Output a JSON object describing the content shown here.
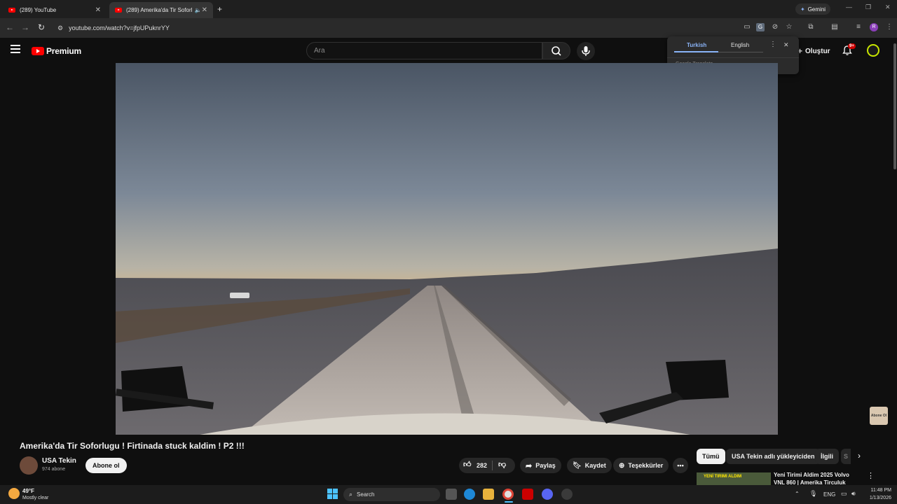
{
  "browser": {
    "tabs": [
      {
        "title": "(289) YouTube"
      },
      {
        "title": "(289) Amerika'da Tir Soforlu"
      }
    ],
    "new_tab": "+",
    "gemini_label": "Gemini",
    "url": "youtube.com/watch?v=jfpUPuknrYY",
    "profile_initial": "R"
  },
  "youtube": {
    "logo_text": "Premium",
    "search_placeholder": "Ara",
    "create_label": "Oluştur",
    "notifications_badge": "9+"
  },
  "translate_popup": {
    "lang_from": "Turkish",
    "lang_to": "English",
    "brand": "Google Translate"
  },
  "video": {
    "title": "Amerika'da Tir Soforlugu ! Firtinada stuck kaldim ! P2 !!!",
    "channel": "USA Tekin",
    "subscribers": "974 abone",
    "subscribe_label": "Abone ol",
    "likes": "282",
    "share_label": "Paylaş",
    "save_label": "Kaydet",
    "thanks_label": "Teşekkürler",
    "watermark_text": "Abone Ol"
  },
  "related": {
    "chips": [
      "Tümü",
      "USA Tekin adlı yükleyiciden",
      "İlgili",
      "S"
    ],
    "first_item_title": "Yeni Tirimi Aldim 2025 Volvo VNL 860 | Amerika Tirculuk",
    "first_item_thumb_text": "YENİ TIRIMI ALDIM"
  },
  "taskbar": {
    "weather_temp": "49°F",
    "weather_desc": "Mostly clear",
    "search_label": "Search",
    "lang": "ENG",
    "time": "11:48 PM",
    "date": "1/13/2026"
  },
  "colors": {
    "youtube_red": "#ff0000",
    "page_bg": "#0f0f0f",
    "chip_active_bg": "#f1f1f1"
  }
}
